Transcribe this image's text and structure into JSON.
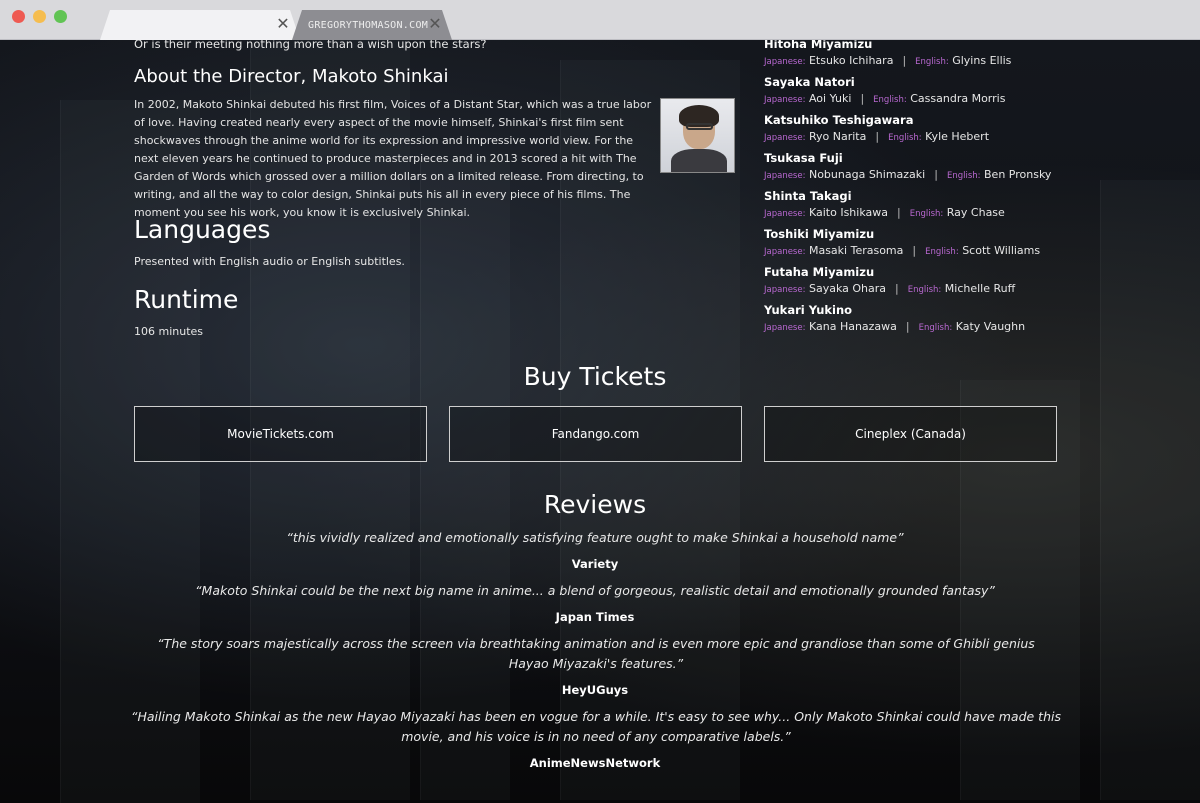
{
  "browser": {
    "tabs": [
      {
        "title": ""
      },
      {
        "title": "GREGORYTHOMASON.COM"
      }
    ]
  },
  "story": {
    "closing_line": "Or is their meeting nothing more than a wish upon the stars?"
  },
  "director": {
    "heading": "About the Director, Makoto Shinkai",
    "paragraph": "In 2002, Makoto Shinkai debuted his first film, Voices of a Distant Star, which was a true labor of love. Having created nearly every aspect of the movie himself, Shinkai's first film sent shockwaves through the anime world for its expression and impressive world view. For the next eleven years he continued to produce masterpieces and in 2013 scored a hit with The Garden of Words which grossed over a million dollars on a limited release. From directing, to writing, and all the way to color design, Shinkai puts his all in every piece of his films. The moment you see his work, you know it is exclusively Shinkai."
  },
  "languages": {
    "heading": "Languages",
    "text": "Presented with English audio or English subtitles."
  },
  "runtime": {
    "heading": "Runtime",
    "text": "106 minutes"
  },
  "cast": {
    "japanese_label": "Japanese:",
    "english_label": "English:",
    "members": [
      {
        "character": "Hitoha Miyamizu",
        "japanese": "Etsuko Ichihara",
        "english": "Glyins Ellis"
      },
      {
        "character": "Sayaka Natori",
        "japanese": "Aoi Yuki",
        "english": "Cassandra Morris"
      },
      {
        "character": "Katsuhiko Teshigawara",
        "japanese": "Ryo Narita",
        "english": "Kyle Hebert"
      },
      {
        "character": "Tsukasa Fuji",
        "japanese": "Nobunaga Shimazaki",
        "english": "Ben Pronsky"
      },
      {
        "character": "Shinta Takagi",
        "japanese": "Kaito Ishikawa",
        "english": "Ray Chase"
      },
      {
        "character": "Toshiki Miyamizu",
        "japanese": "Masaki Terasoma",
        "english": "Scott Williams"
      },
      {
        "character": "Futaha Miyamizu",
        "japanese": "Sayaka Ohara",
        "english": "Michelle Ruff"
      },
      {
        "character": "Yukari Yukino",
        "japanese": "Kana Hanazawa",
        "english": "Katy Vaughn"
      }
    ]
  },
  "tickets": {
    "heading": "Buy Tickets",
    "buttons": [
      {
        "label": "MovieTickets.com"
      },
      {
        "label": "Fandango.com"
      },
      {
        "label": "Cineplex (Canada)"
      }
    ]
  },
  "reviews": {
    "heading": "Reviews",
    "items": [
      {
        "quote": "“this vividly realized and emotionally satisfying feature ought to make Shinkai a household name”",
        "source": "Variety"
      },
      {
        "quote": "“Makoto Shinkai could be the next big name in anime... a blend of gorgeous, realistic detail and emotionally grounded fantasy”",
        "source": "Japan Times"
      },
      {
        "quote": "“The story soars majestically across the screen via breathtaking animation and is even more epic and grandiose than some of Ghibli genius Hayao Miyazaki's features.”",
        "source": "HeyUGuys"
      },
      {
        "quote": "“Hailing Makoto Shinkai as the new Hayao Miyazaki has been en vogue for a while. It's easy to see why... Only Makoto Shinkai could have made this movie, and his voice is in no need of any comparative labels.”",
        "source": "AnimeNewsNetwork"
      }
    ]
  },
  "colors": {
    "accent_label": "#b868d0",
    "background": "#0b0c10"
  }
}
